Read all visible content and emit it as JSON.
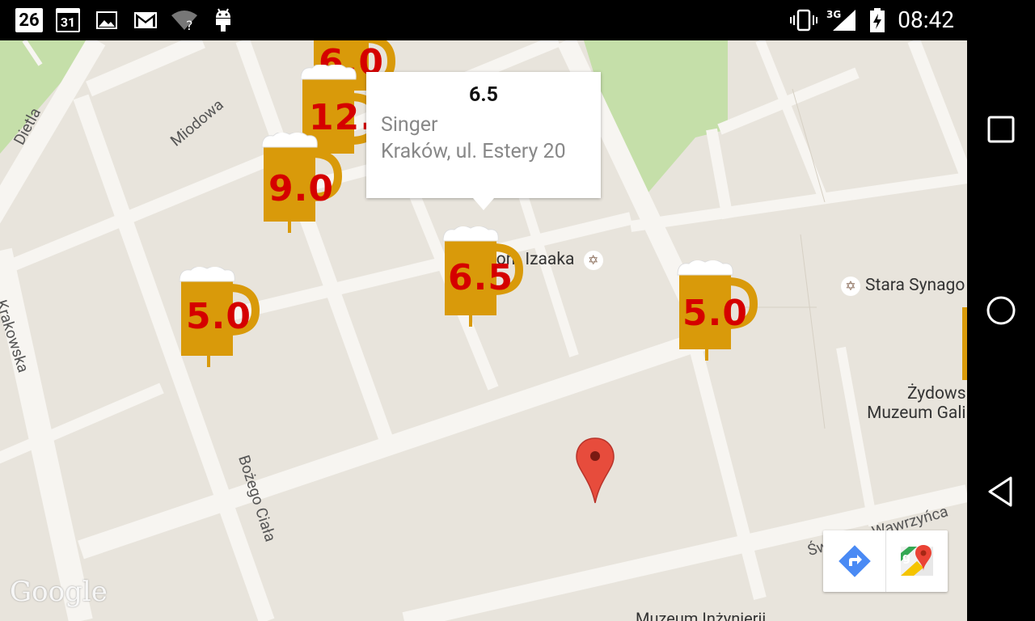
{
  "status_bar": {
    "notification_date": "26",
    "calendar_day": "31",
    "time": "08:42",
    "network": "3G",
    "icons": [
      "notification-date-icon",
      "calendar-icon",
      "gallery-icon",
      "gmail-icon",
      "wifi-unknown-icon",
      "android-icon",
      "vibrate-icon",
      "signal-icon",
      "battery-charging-icon"
    ]
  },
  "map": {
    "streets": {
      "dietla": "Dietla",
      "miodowa": "Miodowa",
      "krakowska": "Krakowska",
      "bozego_ciala": "Bożego Ciała",
      "wawrzynca": "Świętego Wawrzyńca",
      "museum_bottom": "Muzeum Inżynierii"
    },
    "pois": {
      "izaaka": "Dom Izaaka",
      "stara_synagoga": "Stara Synago",
      "zydowskie_line1": "Żydows",
      "zydowskie_line2": "Muzeum Gali"
    },
    "markers": [
      {
        "value": "6.0"
      },
      {
        "value": "12."
      },
      {
        "value": "9.0"
      },
      {
        "value": "5.0"
      },
      {
        "value": "6.5"
      },
      {
        "value": "5.0"
      }
    ],
    "info_window": {
      "title": "6.5",
      "name": "Singer",
      "address": "Kraków, ul. Estery 20"
    },
    "google_logo": "Google",
    "colors": {
      "land": "#e8e4dc",
      "road": "#f7f5f1",
      "park": "#c5dfa9",
      "beer": "#d99a0a",
      "beer_value": "#d50000",
      "pin": "#e74c3c"
    }
  },
  "toolbar": {
    "directions_icon": "directions-icon",
    "maps_icon": "google-maps-icon"
  },
  "nav_bar": {
    "buttons": [
      "recents-icon",
      "home-icon",
      "back-icon"
    ]
  }
}
